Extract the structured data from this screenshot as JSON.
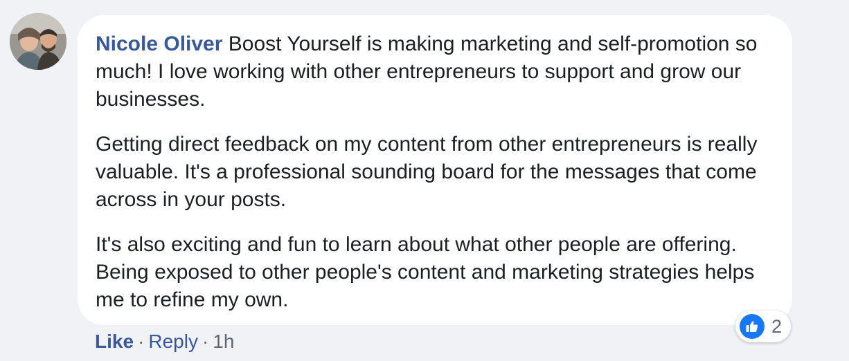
{
  "comment": {
    "author": "Nicole Oliver",
    "paragraphs": [
      "Boost Yourself is making marketing and self-promotion so much! I love working with other entrepreneurs to support and grow our businesses.",
      "Getting direct feedback on my content from other entrepreneurs is really valuable. It's a professional sounding board for the messages that come across in your posts.",
      "It's also exciting and fun to learn about what other people are offering. Being exposed to other people's content and marketing strategies helps me to refine my own."
    ]
  },
  "reactions": {
    "icon": "like-thumbs-up-icon",
    "count": "2",
    "color": "#1877f2"
  },
  "actions": {
    "like_label": "Like",
    "separator": "·",
    "reply_label": "Reply",
    "time": "1h"
  },
  "colors": {
    "link": "#385898",
    "text": "#1c1e21",
    "meta": "#606770",
    "background": "#f0f2f5",
    "bubble": "#ffffff"
  }
}
